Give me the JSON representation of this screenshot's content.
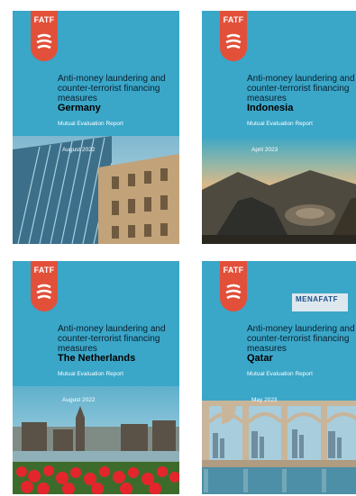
{
  "covers": [
    {
      "badge": "FATF",
      "title": "Anti-money laundering and counter-terrorist financing measures",
      "country": "Germany",
      "report_type": "Mutual Evaluation Report",
      "date": "August 2022"
    },
    {
      "badge": "FATF",
      "title": "Anti-money laundering and counter-terrorist financing measures",
      "country": "Indonesia",
      "report_type": "Mutual Evaluation Report",
      "date": "April 2023"
    },
    {
      "badge": "FATF",
      "title": "Anti-money laundering and counter-terrorist financing measures",
      "country": "The Netherlands",
      "report_type": "Mutual Evaluation Report",
      "date": "August 2022"
    },
    {
      "badge": "FATF",
      "title": "Anti-money laundering and counter-terrorist financing measures",
      "country": "Qatar",
      "report_type": "Mutual Evaluation Report",
      "date": "May 2023",
      "partner_logo": "MENAFATF"
    }
  ],
  "colors": {
    "cover_background": "#3aa6c8",
    "badge": "#e2503a"
  }
}
